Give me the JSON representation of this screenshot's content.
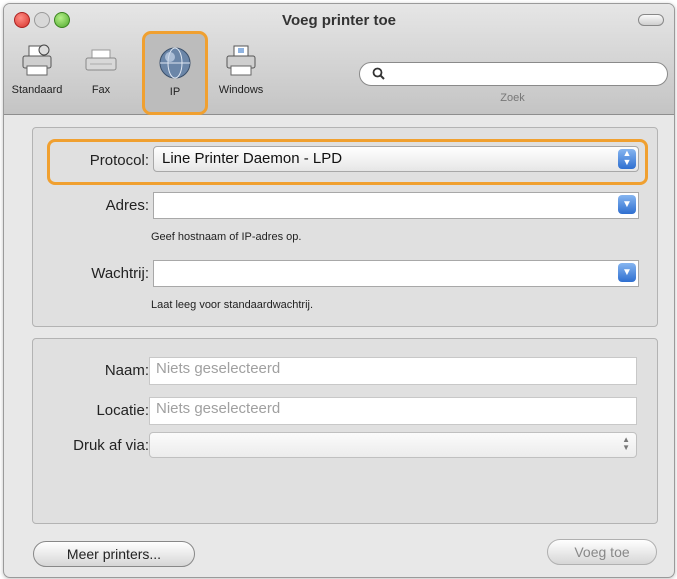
{
  "window": {
    "title": "Voeg printer toe"
  },
  "toolbar": {
    "items": [
      {
        "label": "Standaard",
        "icon": "printer-icon"
      },
      {
        "label": "Fax",
        "icon": "fax-icon"
      },
      {
        "label": "IP",
        "icon": "globe-icon"
      },
      {
        "label": "Windows",
        "icon": "windows-printer-icon"
      }
    ],
    "search_label": "Zoek",
    "search_value": ""
  },
  "protocol_section": {
    "protocol_label": "Protocol:",
    "protocol_value": "Line Printer Daemon - LPD",
    "address_label": "Adres:",
    "address_value": "",
    "address_hint": "Geef hostnaam of IP-adres op.",
    "queue_label": "Wachtrij:",
    "queue_value": "",
    "queue_hint": "Laat leeg voor standaardwachtrij."
  },
  "info_section": {
    "name_label": "Naam:",
    "name_placeholder": "Niets geselecteerd",
    "location_label": "Locatie:",
    "location_placeholder": "Niets geselecteerd",
    "print_via_label": "Druk af via:",
    "print_via_value": ""
  },
  "footer": {
    "more_printers_label": "Meer printers...",
    "add_label": "Voeg toe"
  },
  "colors": {
    "highlight": "#f0a030",
    "accent": "#2f6fd0"
  }
}
